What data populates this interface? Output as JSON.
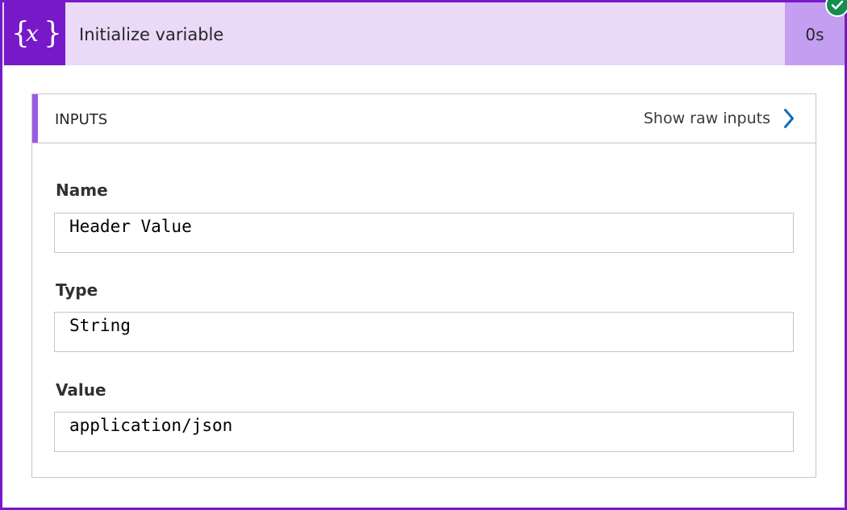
{
  "header": {
    "icon": "variable-braces-icon",
    "title": "Initialize variable",
    "duration": "0s",
    "status": "succeeded"
  },
  "inputs": {
    "section_title": "INPUTS",
    "raw_link_label": "Show raw inputs",
    "fields": [
      {
        "label": "Name",
        "value": "Header Value"
      },
      {
        "label": "Type",
        "value": "String"
      },
      {
        "label": "Value",
        "value": "application/json"
      }
    ]
  },
  "colors": {
    "brand": "#7719c9",
    "header_bg": "#ead9f7",
    "duration_bg": "#c49ef0",
    "accent": "#9b5ae6",
    "link_chevron": "#0f6cbd",
    "success": "#148d4f"
  }
}
